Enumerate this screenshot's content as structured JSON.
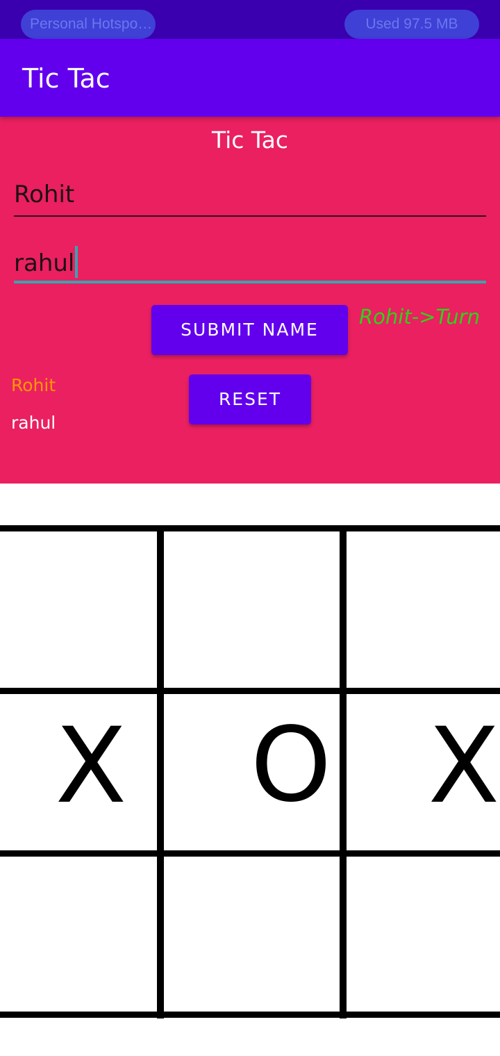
{
  "status_bar": {
    "hotspot_label": "Personal Hotspo…",
    "usage_label": "Used  97.5 MB"
  },
  "app_bar": {
    "title": "Tic Tac"
  },
  "form": {
    "heading": "Tic Tac",
    "player1_input_value": "Rohit",
    "player2_input_value": "rahul",
    "submit_label": "SUBMIT NAME",
    "reset_label": "RESET",
    "turn_indicator": "Rohit->Turn",
    "player1_name": "Rohit",
    "player2_name": "rahul"
  },
  "colors": {
    "status_bar": "#3a00b0",
    "app_bar": "#6200ee",
    "panel": "#ea2060",
    "accent": "#36a5b0",
    "turn_text": "#2fd318",
    "player1_text": "#ff9800"
  },
  "board": {
    "cells": [
      [
        "",
        "",
        ""
      ],
      [
        "X",
        "O",
        "X"
      ],
      [
        "",
        "",
        ""
      ]
    ]
  }
}
